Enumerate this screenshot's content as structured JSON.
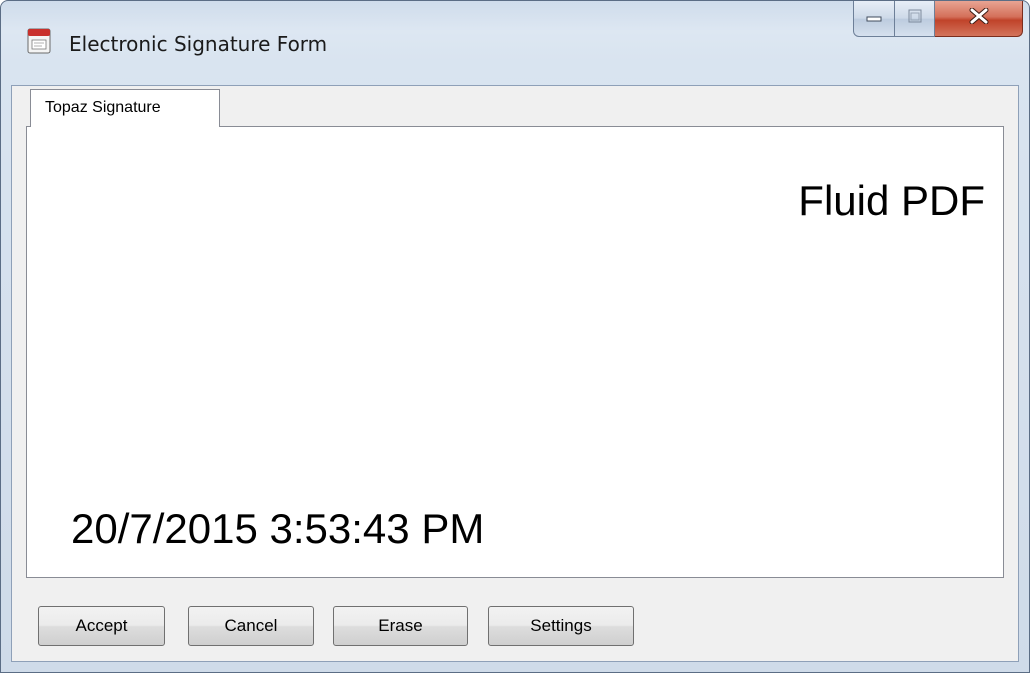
{
  "window": {
    "title": "Electronic Signature Form",
    "icon": "fluid-pdf-app-icon",
    "caption_buttons": [
      "minimize-icon",
      "maximize-icon",
      "close-icon"
    ]
  },
  "tabs": [
    {
      "label": "Topaz Signature",
      "selected": true
    }
  ],
  "signature_pad": {
    "label": "Fluid PDF",
    "datetime": "20/7/2015 3:53:43 PM"
  },
  "buttons": {
    "accept": "Accept",
    "cancel": "Cancel",
    "erase": "Erase",
    "settings": "Settings"
  },
  "colors": {
    "close_button": "#c7492f",
    "frame": "#d9e4f0",
    "client_bg": "#f0f0f0"
  }
}
